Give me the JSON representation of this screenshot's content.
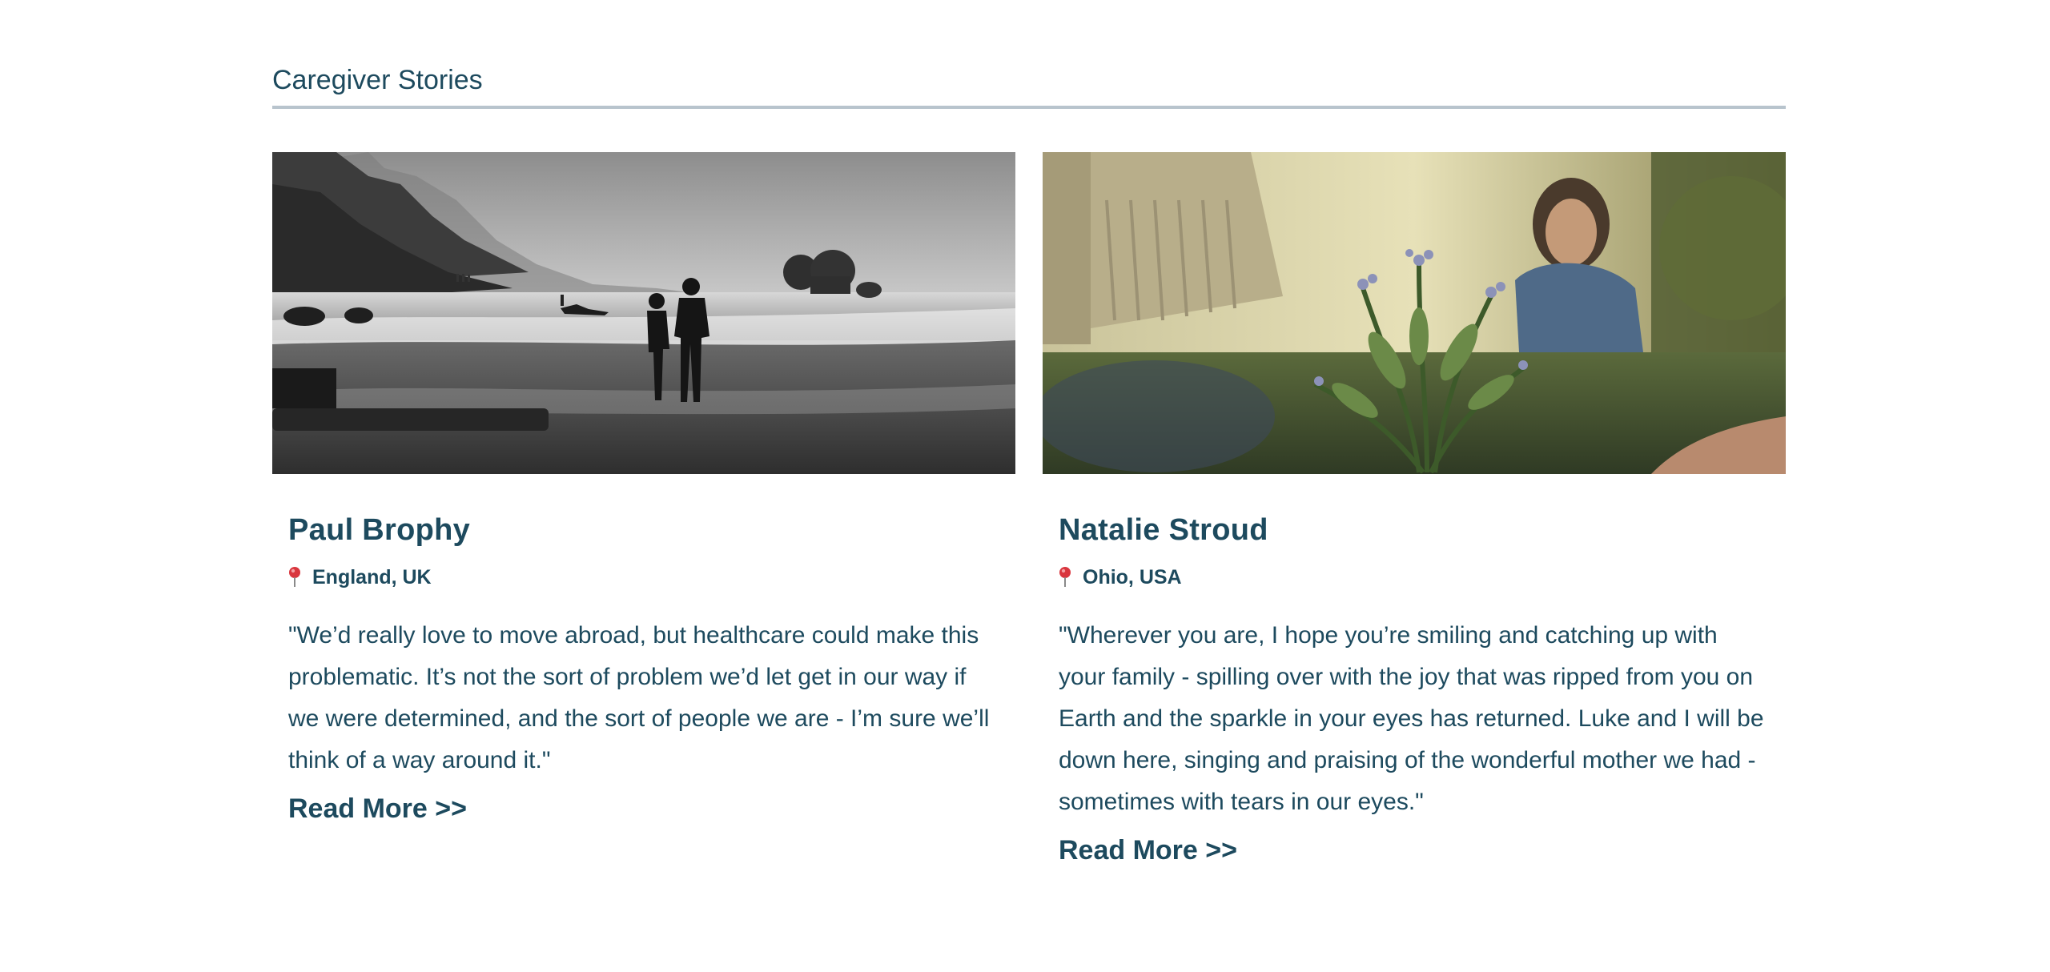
{
  "section": {
    "title": "Caregiver Stories"
  },
  "colors": {
    "text": "#1d4a5e",
    "divider": "#b8c4cd",
    "pin": "#d9363e"
  },
  "stories": [
    {
      "name": "Paul Brophy",
      "location": "England, UK",
      "location_icon": "map-pin-icon",
      "quote": "\"We’d really love to move abroad, but healthcare could make this problematic. It’s not the sort of problem we’d let get in our way if we were determined, and the sort of people we are - I’m sure we’ll think of a way around it.\"",
      "read_more": "Read More >>"
    },
    {
      "name": "Natalie Stroud",
      "location": "Ohio, USA",
      "location_icon": "map-pin-icon",
      "quote": "\"Wherever you are, I hope you’re smiling and catching up with your family - spilling over with the joy that was ripped from you on Earth and the sparkle in your eyes has returned. Luke and I will be down here, singing and praising of the wonderful mother we had - sometimes with tears in our eyes.\"",
      "read_more": "Read More >>"
    }
  ]
}
